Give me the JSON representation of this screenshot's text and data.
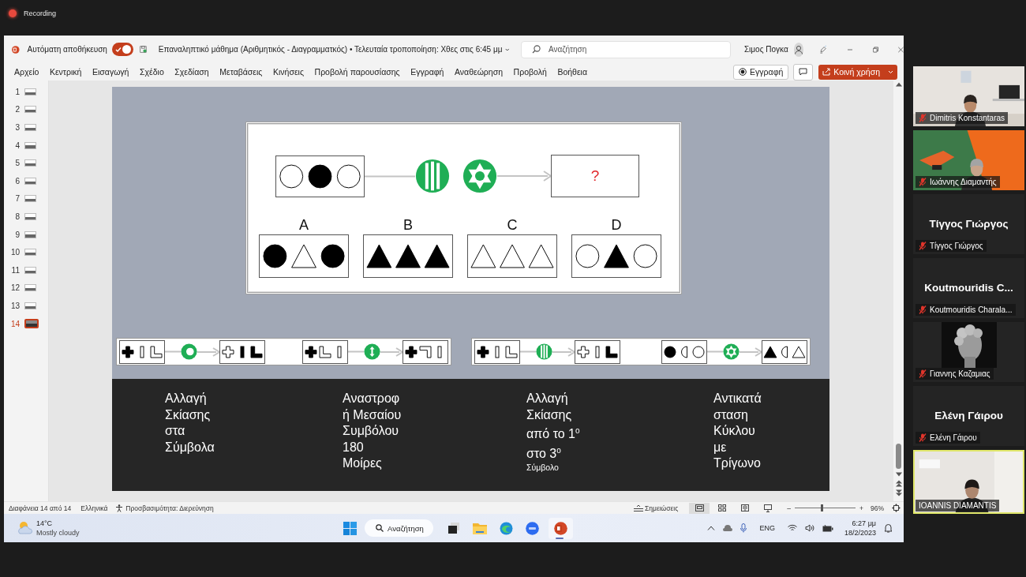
{
  "recording": {
    "label": "Recording"
  },
  "window": {
    "autosave": {
      "label": "Αυτόματη αποθήκευση",
      "on": true
    },
    "title": "Επαναληπτικό μάθημα (Αριθμητικός - Διαγραμματκός) • Τελευταία τροποποίηση: Χθες στις 6:45 μμ",
    "search": {
      "placeholder": "Αναζήτηση"
    },
    "user": "Σιμος Πογκα"
  },
  "ribbon": {
    "tabs": [
      "Αρχείο",
      "Κεντρική",
      "Εισαγωγή",
      "Σχέδιο",
      "Σχεδίαση",
      "Μεταβάσεις",
      "Κινήσεις",
      "Προβολή παρουσίασης",
      "Εγγραφή",
      "Αναθεώρηση",
      "Προβολή",
      "Βοήθεια"
    ],
    "record_button": "Εγγραφή",
    "share_button": "Κοινή χρήση"
  },
  "thumbnails": [
    {
      "number": "1",
      "selected": false
    },
    {
      "number": "2",
      "selected": false
    },
    {
      "number": "3",
      "selected": false
    },
    {
      "number": "4",
      "selected": false
    },
    {
      "number": "5",
      "selected": false
    },
    {
      "number": "6",
      "selected": false
    },
    {
      "number": "7",
      "selected": false
    },
    {
      "number": "8",
      "selected": false
    },
    {
      "number": "9",
      "selected": false
    },
    {
      "number": "10",
      "selected": false
    },
    {
      "number": "11",
      "selected": false
    },
    {
      "number": "12",
      "selected": false
    },
    {
      "number": "13",
      "selected": false
    },
    {
      "number": "14",
      "selected": true
    }
  ],
  "slide": {
    "puzzle": {
      "start": [
        {
          "kind": "circle",
          "filled": false
        },
        {
          "kind": "circle",
          "filled": true
        },
        {
          "kind": "circle",
          "filled": false
        }
      ],
      "rules": [
        {
          "kind": "bars"
        },
        {
          "kind": "star"
        }
      ],
      "answer": "?",
      "options": [
        {
          "letter": "A",
          "symbols": [
            {
              "kind": "circle",
              "filled": true
            },
            {
              "kind": "triangle",
              "filled": false
            },
            {
              "kind": "circle",
              "filled": true
            }
          ]
        },
        {
          "letter": "B",
          "symbols": [
            {
              "kind": "triangle",
              "filled": true
            },
            {
              "kind": "triangle",
              "filled": true
            },
            {
              "kind": "triangle",
              "filled": true
            }
          ]
        },
        {
          "letter": "C",
          "symbols": [
            {
              "kind": "triangle",
              "filled": false
            },
            {
              "kind": "triangle",
              "filled": false
            },
            {
              "kind": "triangle",
              "filled": false
            }
          ]
        },
        {
          "letter": "D",
          "symbols": [
            {
              "kind": "circle",
              "filled": false
            },
            {
              "kind": "triangle",
              "filled": true
            },
            {
              "kind": "circle",
              "filled": false
            }
          ]
        }
      ]
    },
    "strips": [
      {
        "groups": [
          {
            "before": [
              {
                "kind": "plus",
                "filled": true
              },
              {
                "kind": "bar",
                "filled": false
              },
              {
                "kind": "corner",
                "filled": false
              }
            ],
            "rule": {
              "kind": "ring"
            },
            "after": [
              {
                "kind": "plus",
                "filled": false
              },
              {
                "kind": "bar",
                "filled": true
              },
              {
                "kind": "corner",
                "filled": true
              }
            ]
          },
          {
            "before": [
              {
                "kind": "plus",
                "filled": true
              },
              {
                "kind": "corner",
                "filled": false
              },
              {
                "kind": "bar",
                "filled": false
              }
            ],
            "rule": {
              "kind": "flip"
            },
            "after": [
              {
                "kind": "plus",
                "filled": true
              },
              {
                "kind": "corner-flipped",
                "filled": false
              },
              {
                "kind": "bar",
                "filled": false
              }
            ]
          }
        ]
      },
      {
        "groups": [
          {
            "before": [
              {
                "kind": "plus",
                "filled": true
              },
              {
                "kind": "bar",
                "filled": false
              },
              {
                "kind": "corner",
                "filled": false
              }
            ],
            "rule": {
              "kind": "bars"
            },
            "after": [
              {
                "kind": "plus",
                "filled": false
              },
              {
                "kind": "bar",
                "filled": false
              },
              {
                "kind": "corner",
                "filled": true
              }
            ]
          },
          {
            "before": [
              {
                "kind": "circle",
                "filled": true
              },
              {
                "kind": "half",
                "filled": false
              },
              {
                "kind": "circle",
                "filled": false
              }
            ],
            "rule": {
              "kind": "star"
            },
            "after": [
              {
                "kind": "triangle",
                "filled": true
              },
              {
                "kind": "half",
                "filled": false
              },
              {
                "kind": "triangle",
                "filled": false
              }
            ]
          }
        ]
      }
    ],
    "captions": [
      {
        "lines": [
          "Αλλαγή",
          "Σκίασης",
          "στα",
          "Σύμβολα"
        ]
      },
      {
        "lines": [
          "Αναστροφ",
          "ή Μεσαίου",
          "Συμβόλου",
          "180",
          "Μοίρες"
        ]
      },
      {
        "lines": [
          "Αλλαγή",
          "Σκίασης",
          "από το 1$^{ο}$",
          "στο 3$^{ο}$"
        ],
        "note": "Σύμβολο"
      },
      {
        "lines": [
          "Αντικατά",
          "σταση",
          "Κύκλου",
          "με",
          "Τρίγωνο"
        ]
      }
    ]
  },
  "status_bar": {
    "slide": "Διαφάνεια 14 από 14",
    "language": "Ελληνικά",
    "accessibility": "Προσβασιμότητα: Διερεύνηση",
    "notes": "Σημειώσεις",
    "zoom": {
      "minus": "–",
      "plus": "+",
      "level": 0.45,
      "percent": "96%"
    }
  },
  "taskbar": {
    "temperature": "14°C",
    "weather": "Mostly cloudy",
    "search": "Αναζήτηση",
    "language": "ENG",
    "time": "6:27 μμ",
    "date": "18/2/2023"
  },
  "participants": [
    {
      "kind": "video",
      "name": "Dimitris Konstantaras",
      "muted": true,
      "speaking": false
    },
    {
      "kind": "video",
      "name": "Ιωάννης Διαμαντής",
      "muted": true,
      "speaking": false
    },
    {
      "kind": "name",
      "display": "Τίγγος Γιώργος",
      "name": "Τίγγος Γιώργος",
      "muted": true,
      "speaking": false
    },
    {
      "kind": "name",
      "display": "Koutmouridis  C...",
      "name": "Koutmouridis Charala...",
      "muted": true,
      "speaking": false
    },
    {
      "kind": "picture",
      "name": "Γιαννης Καζαμιας",
      "muted": true,
      "speaking": false
    },
    {
      "kind": "name",
      "display": "Ελένη Γάιρου",
      "name": "Ελένη Γάιρου",
      "muted": true,
      "speaking": false
    },
    {
      "kind": "video",
      "name": "IOANNIS DIAMANTIS",
      "muted": false,
      "speaking": true
    }
  ]
}
